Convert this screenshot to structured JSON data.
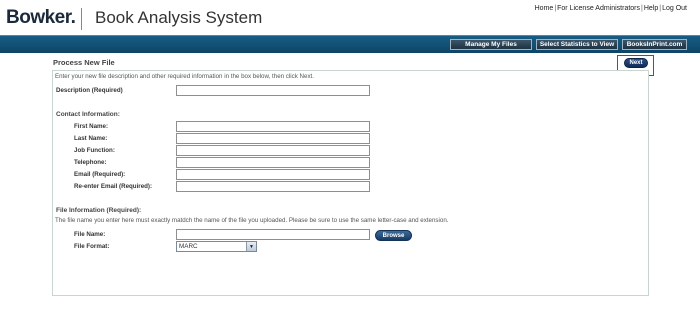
{
  "brand": {
    "logo": "Bowker.",
    "title": "Book Analysis System"
  },
  "top_links": [
    "Home",
    "For License Administrators",
    "Help",
    "Log Out"
  ],
  "nav": {
    "manage_files": "Manage My Files",
    "select_stats": "Select Statistics to View",
    "booksinprint": "BooksInPrint.com"
  },
  "form": {
    "heading": "Process New File",
    "intro": "Enter your new file description and other required information in the box below, then click Next.",
    "next_label": "Next",
    "description_label": "Description (Required)",
    "description_value": "",
    "contact_section": "Contact Information:",
    "contact_fields": [
      {
        "label": "First Name:",
        "value": ""
      },
      {
        "label": "Last Name:",
        "value": ""
      },
      {
        "label": "Job Function:",
        "value": ""
      },
      {
        "label": "Telephone:",
        "value": ""
      },
      {
        "label": "Email (Required):",
        "value": ""
      },
      {
        "label": "Re-enter Email (Required):",
        "value": ""
      }
    ],
    "file_section": "File Information (Required):",
    "file_note": "The file name you enter here must exactly matdch the name of the file you uploaded.  Please be sure to use the same letter-case and extension.",
    "file_name_label": "File Name:",
    "file_name_value": "",
    "browse_label": "Browse",
    "file_format_label": "File Format:",
    "file_format_selected": "MARC"
  }
}
